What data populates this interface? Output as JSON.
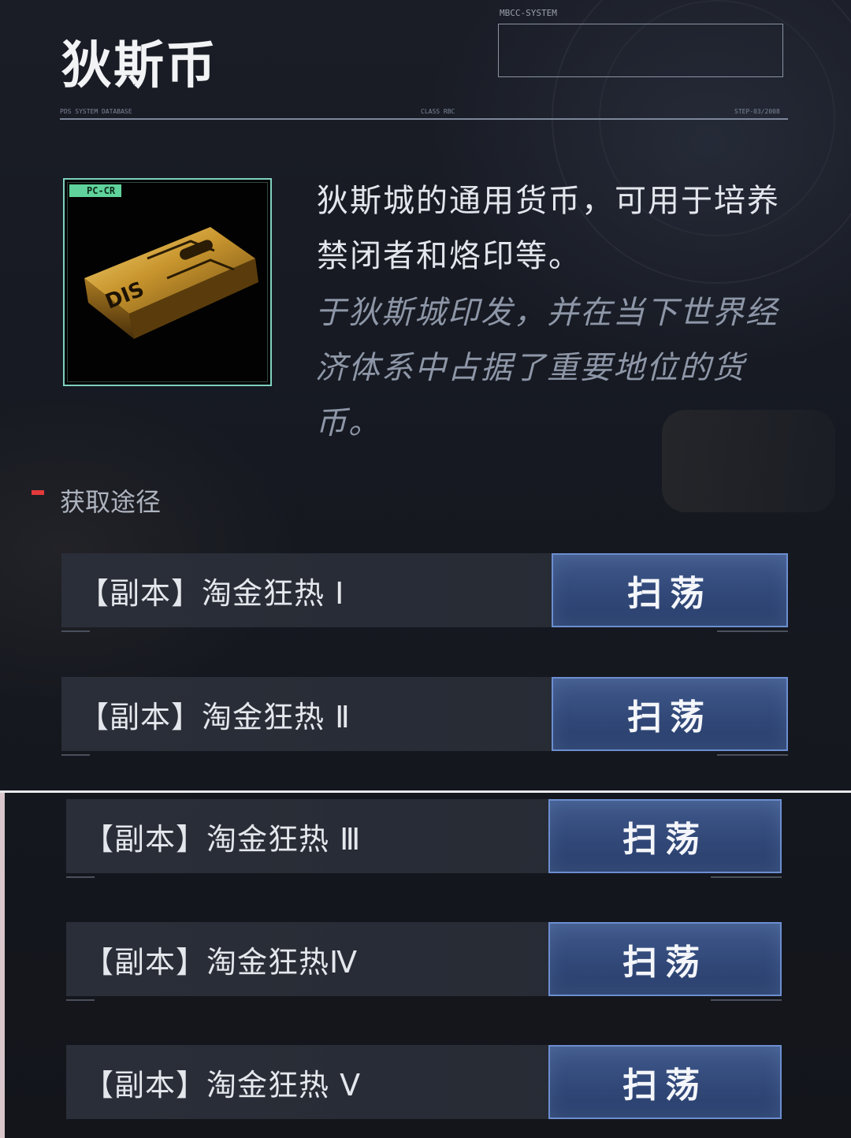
{
  "header": {
    "title": "狄斯币",
    "system_label": "MBCC-SYSTEM",
    "rule_left": "PDS SYSTEM DATABASE",
    "rule_mid": "CLASS RBC",
    "rule_right": "STEP-03/2008"
  },
  "item": {
    "tag": "PC-CR",
    "card_text": "DIS",
    "description": "狄斯城的通用货币，可用于培养禁闭者和烙印等。",
    "flavor": "于狄斯城印发，并在当下世界经济体系中占据了重要地位的货币。"
  },
  "sources": {
    "title": "获取途径",
    "rows": [
      {
        "label": "【副本】淘金狂热 Ⅰ",
        "button": "扫荡"
      },
      {
        "label": "【副本】淘金狂热 Ⅱ",
        "button": "扫荡"
      },
      {
        "label": "【副本】淘金狂热 Ⅲ",
        "button": "扫荡"
      },
      {
        "label": "【副本】淘金狂热Ⅳ",
        "button": "扫荡"
      },
      {
        "label": "【副本】淘金狂热 Ⅴ",
        "button": "扫荡"
      }
    ]
  },
  "colors": {
    "accent_red": "#e23a3a",
    "button_blue": "#314878",
    "tag_green": "#5fd39b"
  }
}
